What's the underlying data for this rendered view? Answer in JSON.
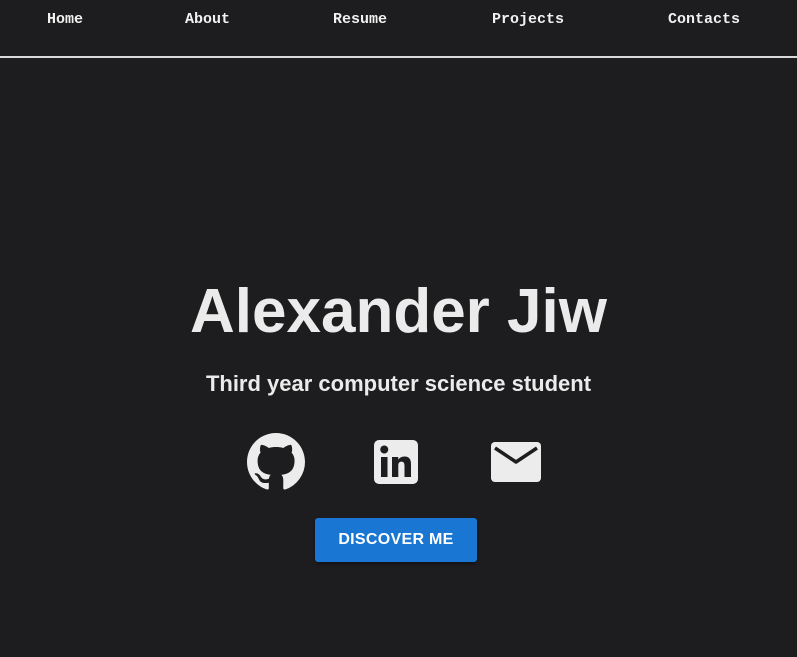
{
  "nav": {
    "items": [
      {
        "label": "Home"
      },
      {
        "label": "About"
      },
      {
        "label": "Resume"
      },
      {
        "label": "Projects"
      },
      {
        "label": "Contacts"
      }
    ]
  },
  "hero": {
    "name": "Alexander Jiw",
    "subtitle": "Third year computer science student",
    "cta_label": "DISCOVER ME"
  },
  "social": {
    "icons": [
      "github-icon",
      "linkedin-icon",
      "email-icon"
    ]
  },
  "colors": {
    "background": "#1d1d1f",
    "text": "#ececec",
    "accent": "#1976d2",
    "nav_divider": "#d9d9d9"
  }
}
